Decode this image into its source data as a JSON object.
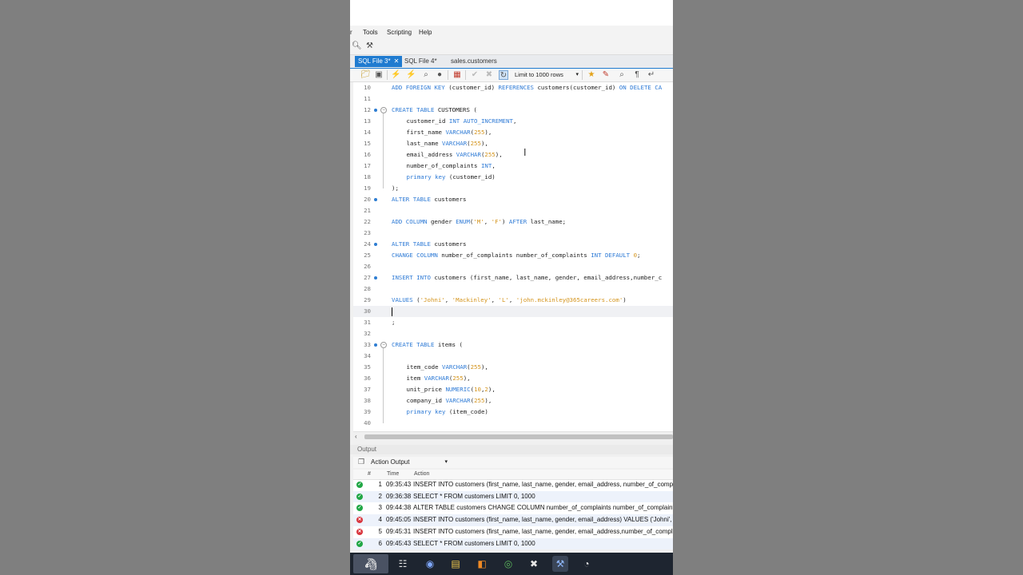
{
  "menu": [
    "r",
    "Tools",
    "Scripting",
    "Help"
  ],
  "tabs": [
    {
      "label": "SQL File 3*",
      "active": true,
      "closable": true
    },
    {
      "label": "SQL File 4*",
      "active": false,
      "closable": false
    },
    {
      "label": "sales.customers",
      "active": false,
      "closable": false
    }
  ],
  "toolbar": {
    "icons": [
      "open-folder-icon",
      "save-icon",
      "execute-icon",
      "execute-selection-icon",
      "explain-icon",
      "stop-icon",
      "toggle-results-icon",
      "commit-icon",
      "rollback-icon",
      "auto-commit-icon"
    ],
    "limit_label": "Limit to 1000 rows",
    "right_icons": [
      "beautify-icon",
      "comment-icon",
      "find-icon",
      "invisible-chars-icon",
      "wrap-icon"
    ]
  },
  "editor": {
    "lines": [
      {
        "n": "10",
        "dot": false,
        "fold": false,
        "indent": 0,
        "tokens": [
          [
            "kw",
            "ADD FOREIGN KEY "
          ],
          [
            "t",
            "(customer_id) "
          ],
          [
            "kw",
            "REFERENCES "
          ],
          [
            "t",
            "customers(customer_id) "
          ],
          [
            "kw",
            "ON DELETE CA"
          ]
        ]
      },
      {
        "n": "11",
        "dot": false,
        "fold": false,
        "indent": 0,
        "tokens": []
      },
      {
        "n": "12",
        "dot": true,
        "fold": true,
        "indent": 0,
        "tokens": [
          [
            "kw",
            "CREATE TABLE "
          ],
          [
            "t",
            "CUSTOMERS ("
          ]
        ]
      },
      {
        "n": "13",
        "dot": false,
        "fold": false,
        "indent": 1,
        "tokens": [
          [
            "t",
            "customer_id "
          ],
          [
            "kw",
            "INT AUTO_INCREMENT"
          ],
          [
            "t",
            ","
          ]
        ]
      },
      {
        "n": "14",
        "dot": false,
        "fold": false,
        "indent": 1,
        "tokens": [
          [
            "t",
            "first_name "
          ],
          [
            "kw",
            "VARCHAR"
          ],
          [
            "t",
            "("
          ],
          [
            "num",
            "255"
          ],
          [
            "t",
            "),"
          ]
        ]
      },
      {
        "n": "15",
        "dot": false,
        "fold": false,
        "indent": 1,
        "tokens": [
          [
            "t",
            "last_name "
          ],
          [
            "kw",
            "VARCHAR"
          ],
          [
            "t",
            "("
          ],
          [
            "num",
            "255"
          ],
          [
            "t",
            "),"
          ]
        ]
      },
      {
        "n": "16",
        "dot": false,
        "fold": false,
        "indent": 1,
        "tokens": [
          [
            "t",
            "email_address "
          ],
          [
            "kw",
            "VARCHAR"
          ],
          [
            "t",
            "("
          ],
          [
            "num",
            "255"
          ],
          [
            "t",
            "),"
          ]
        ]
      },
      {
        "n": "17",
        "dot": false,
        "fold": false,
        "indent": 1,
        "tokens": [
          [
            "t",
            "number_of_complaints "
          ],
          [
            "kw",
            "INT"
          ],
          [
            "t",
            ","
          ]
        ]
      },
      {
        "n": "18",
        "dot": false,
        "fold": false,
        "indent": 1,
        "tokens": [
          [
            "kw",
            "primary key "
          ],
          [
            "t",
            "(customer_id)"
          ]
        ]
      },
      {
        "n": "19",
        "dot": false,
        "fold": false,
        "indent": 0,
        "tokens": [
          [
            "t",
            ");"
          ]
        ]
      },
      {
        "n": "20",
        "dot": true,
        "fold": false,
        "indent": 0,
        "tokens": [
          [
            "kw",
            "ALTER TABLE "
          ],
          [
            "t",
            "customers"
          ]
        ]
      },
      {
        "n": "21",
        "dot": false,
        "fold": false,
        "indent": 0,
        "tokens": []
      },
      {
        "n": "22",
        "dot": false,
        "fold": false,
        "indent": 0,
        "tokens": [
          [
            "kw",
            "ADD COLUMN "
          ],
          [
            "t",
            "gender "
          ],
          [
            "kw",
            "ENUM"
          ],
          [
            "t",
            "("
          ],
          [
            "str",
            "'M'"
          ],
          [
            "t",
            ", "
          ],
          [
            "str",
            "'F'"
          ],
          [
            "t",
            ") "
          ],
          [
            "kw",
            "AFTER "
          ],
          [
            "t",
            "last_name;"
          ]
        ]
      },
      {
        "n": "23",
        "dot": false,
        "fold": false,
        "indent": 0,
        "tokens": []
      },
      {
        "n": "24",
        "dot": true,
        "fold": false,
        "indent": 0,
        "tokens": [
          [
            "kw",
            "ALTER TABLE "
          ],
          [
            "t",
            "customers"
          ]
        ]
      },
      {
        "n": "25",
        "dot": false,
        "fold": false,
        "indent": 0,
        "tokens": [
          [
            "kw",
            "CHANGE COLUMN "
          ],
          [
            "t",
            "number_of_complaints number_of_complaints "
          ],
          [
            "kw",
            "INT DEFAULT "
          ],
          [
            "num",
            "0"
          ],
          [
            "t",
            ";"
          ]
        ]
      },
      {
        "n": "26",
        "dot": false,
        "fold": false,
        "indent": 0,
        "tokens": []
      },
      {
        "n": "27",
        "dot": true,
        "fold": false,
        "indent": 0,
        "tokens": [
          [
            "kw",
            "INSERT INTO "
          ],
          [
            "t",
            "customers (first_name, last_name, gender, email_address,number_c"
          ]
        ]
      },
      {
        "n": "28",
        "dot": false,
        "fold": false,
        "indent": 0,
        "tokens": []
      },
      {
        "n": "29",
        "dot": false,
        "fold": false,
        "indent": 0,
        "tokens": [
          [
            "kw",
            "VALUES "
          ],
          [
            "t",
            "("
          ],
          [
            "str",
            "'Johni'"
          ],
          [
            "t",
            ", "
          ],
          [
            "str",
            "'Mackinley'"
          ],
          [
            "t",
            ", "
          ],
          [
            "str",
            "'L'"
          ],
          [
            "t",
            ", "
          ],
          [
            "str",
            "'john.mckinley@365careers.com'"
          ],
          [
            "t",
            ")"
          ]
        ]
      },
      {
        "n": "30",
        "dot": false,
        "fold": false,
        "indent": 0,
        "current": true,
        "tokens": []
      },
      {
        "n": "31",
        "dot": false,
        "fold": false,
        "indent": 0,
        "tokens": [
          [
            "t",
            ";"
          ]
        ]
      },
      {
        "n": "32",
        "dot": false,
        "fold": false,
        "indent": 0,
        "tokens": []
      },
      {
        "n": "33",
        "dot": true,
        "fold": true,
        "indent": 0,
        "tokens": [
          [
            "kw",
            "CREATE TABLE "
          ],
          [
            "t",
            "items ("
          ]
        ]
      },
      {
        "n": "34",
        "dot": false,
        "fold": false,
        "indent": 0,
        "tokens": []
      },
      {
        "n": "35",
        "dot": false,
        "fold": false,
        "indent": 1,
        "tokens": [
          [
            "t",
            "item_code "
          ],
          [
            "kw",
            "VARCHAR"
          ],
          [
            "t",
            "("
          ],
          [
            "num",
            "255"
          ],
          [
            "t",
            "),"
          ]
        ]
      },
      {
        "n": "36",
        "dot": false,
        "fold": false,
        "indent": 1,
        "tokens": [
          [
            "t",
            "item "
          ],
          [
            "kw",
            "VARCHAR"
          ],
          [
            "t",
            "("
          ],
          [
            "num",
            "255"
          ],
          [
            "t",
            "),"
          ]
        ]
      },
      {
        "n": "37",
        "dot": false,
        "fold": false,
        "indent": 1,
        "tokens": [
          [
            "t",
            "unit_price "
          ],
          [
            "kw",
            "NUMERIC"
          ],
          [
            "t",
            "("
          ],
          [
            "num",
            "10"
          ],
          [
            "t",
            ","
          ],
          [
            "num",
            "2"
          ],
          [
            "t",
            "),"
          ]
        ]
      },
      {
        "n": "38",
        "dot": false,
        "fold": false,
        "indent": 1,
        "tokens": [
          [
            "t",
            "company_id "
          ],
          [
            "kw",
            "VARCHAR"
          ],
          [
            "t",
            "("
          ],
          [
            "num",
            "255"
          ],
          [
            "t",
            "),"
          ]
        ]
      },
      {
        "n": "39",
        "dot": false,
        "fold": false,
        "indent": 1,
        "tokens": [
          [
            "kw",
            "primary key "
          ],
          [
            "t",
            "(item_code)"
          ]
        ]
      },
      {
        "n": "40",
        "dot": false,
        "fold": false,
        "indent": 0,
        "tokens": []
      }
    ]
  },
  "output": {
    "title": "Output",
    "selector": "Action Output",
    "columns": {
      "num": "#",
      "time": "Time",
      "action": "Action"
    },
    "rows": [
      {
        "status": "ok",
        "num": "1",
        "time": "09:35:43",
        "action": "INSERT INTO customers (first_name, last_name, gender, email_address, number_of_complaints)  VALU"
      },
      {
        "status": "ok",
        "num": "2",
        "time": "09:36:38",
        "action": "SELECT * FROM customers LIMIT 0, 1000"
      },
      {
        "status": "ok",
        "num": "3",
        "time": "09:44:38",
        "action": "ALTER TABLE customers CHANGE COLUMN number_of_complaints number_of_complaints INT DEFA"
      },
      {
        "status": "err",
        "num": "4",
        "time": "09:45:05",
        "action": "INSERT INTO customers (first_name, last_name, gender, email_address)  VALUES ('Johni', 'Mackinley',"
      },
      {
        "status": "err",
        "num": "5",
        "time": "09:45:31",
        "action": "INSERT INTO customers (first_name, last_name, gender, email_address,number_of_complaints)  VALU"
      },
      {
        "status": "ok",
        "num": "6",
        "time": "09:45:43",
        "action": "SELECT * FROM customers LIMIT 0, 1000"
      }
    ]
  },
  "taskbar": {
    "icons": [
      "zebra-wallpaper-icon",
      "task-view-icon",
      "copilot-icon",
      "file-explorer-icon",
      "app-orange-icon",
      "chrome-icon",
      "capcut-icon",
      "mysql-workbench-icon",
      "obs-icon"
    ]
  },
  "colors": {
    "accent": "#1f7bd0",
    "keyword": "#2f7bd6",
    "string": "#d4941c",
    "ok": "#21a745",
    "error": "#d9363e"
  }
}
